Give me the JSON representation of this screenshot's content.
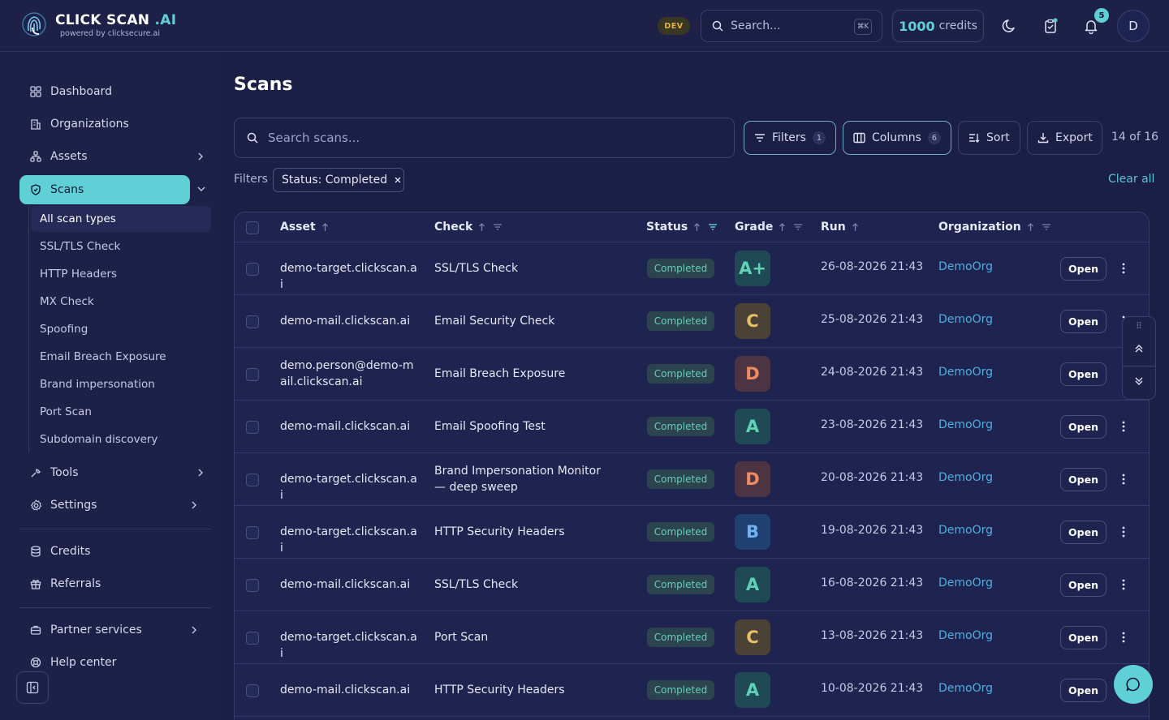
{
  "brand": {
    "name_main": "CLICK SCAN ",
    "name_accent": ".AI",
    "tagline": "powered by clicksecure.ai"
  },
  "header": {
    "env_badge": "DEV",
    "search_placeholder": "Search...",
    "search_shortcut": "⌘K",
    "credits_value": "1000",
    "credits_label": "credits",
    "notification_count": "5",
    "avatar_initial": "D"
  },
  "sidebar": {
    "items": [
      {
        "label": "Dashboard",
        "icon": "grid-icon"
      },
      {
        "label": "Organizations",
        "icon": "building-icon"
      },
      {
        "label": "Assets",
        "icon": "network-icon"
      },
      {
        "label": "Scans",
        "icon": "shield-icon"
      }
    ],
    "scan_subitems": [
      "All scan types",
      "SSL/TLS Check",
      "HTTP Headers",
      "MX Check",
      "Spoofing",
      "Email Breach Exposure",
      "Brand impersonation",
      "Port Scan",
      "Subdomain discovery"
    ],
    "items_after": [
      {
        "label": "Tools",
        "icon": "wrench-icon"
      },
      {
        "label": "Settings",
        "icon": "gear-icon"
      }
    ],
    "group2": [
      {
        "label": "Credits",
        "icon": "database-icon"
      },
      {
        "label": "Referrals",
        "icon": "gift-icon"
      }
    ],
    "group3": [
      {
        "label": "Partner services",
        "icon": "briefcase-icon"
      },
      {
        "label": "Help center",
        "icon": "lifebuoy-icon"
      }
    ]
  },
  "main": {
    "title": "Scans",
    "search_placeholder": "Search scans...",
    "toolbar": {
      "filters_label": "Filters",
      "filters_count": "1",
      "columns_label": "Columns",
      "columns_count": "6",
      "sort_label": "Sort",
      "export_label": "Export",
      "pagination": "14 of 16"
    },
    "active_filters_label": "Filters",
    "active_filter_chip": "Status: Completed",
    "clear_all": "Clear all"
  },
  "table": {
    "columns": [
      "Asset",
      "Check",
      "Status",
      "Grade",
      "Run",
      "Organization"
    ],
    "open_label": "Open",
    "rows": [
      {
        "asset": "demo-target.clickscan.ai",
        "check": "SSL/TLS Check",
        "status": "Completed",
        "grade": "A+",
        "run": "26-08-2026 21:43",
        "org": "DemoOrg"
      },
      {
        "asset": "demo-mail.clickscan.ai",
        "check": "Email Security Check",
        "status": "Completed",
        "grade": "C",
        "run": "25-08-2026 21:43",
        "org": "DemoOrg"
      },
      {
        "asset": "demo.person@demo-mail.clickscan.ai",
        "check": "Email Breach Exposure",
        "status": "Completed",
        "grade": "D",
        "run": "24-08-2026 21:43",
        "org": "DemoOrg"
      },
      {
        "asset": "demo-mail.clickscan.ai",
        "check": "Email Spoofing Test",
        "status": "Completed",
        "grade": "A",
        "run": "23-08-2026 21:43",
        "org": "DemoOrg"
      },
      {
        "asset": "demo-target.clickscan.ai",
        "check": "Brand Impersonation Monitor — deep sweep",
        "status": "Completed",
        "grade": "D",
        "run": "20-08-2026 21:43",
        "org": "DemoOrg"
      },
      {
        "asset": "demo-target.clickscan.ai",
        "check": "HTTP Security Headers",
        "status": "Completed",
        "grade": "B",
        "run": "19-08-2026 21:43",
        "org": "DemoOrg"
      },
      {
        "asset": "demo-mail.clickscan.ai",
        "check": "SSL/TLS Check",
        "status": "Completed",
        "grade": "A",
        "run": "16-08-2026 21:43",
        "org": "DemoOrg"
      },
      {
        "asset": "demo-target.clickscan.ai",
        "check": "Port Scan",
        "status": "Completed",
        "grade": "C",
        "run": "13-08-2026 21:43",
        "org": "DemoOrg"
      },
      {
        "asset": "demo-mail.clickscan.ai",
        "check": "HTTP Security Headers",
        "status": "Completed",
        "grade": "A",
        "run": "10-08-2026 21:43",
        "org": "DemoOrg"
      }
    ]
  },
  "colors": {
    "accent": "#5fd1d6",
    "background": "#1b1f45",
    "grade_a_bg": "#1f4a55",
    "grade_a_fg": "#5fd1b4",
    "grade_b_bg": "#1f4070",
    "grade_b_fg": "#6fb4f0",
    "grade_c_bg": "#4a4234",
    "grade_c_fg": "#e6bf6a",
    "grade_d_bg": "#4c3442",
    "grade_d_fg": "#ef8a62"
  }
}
